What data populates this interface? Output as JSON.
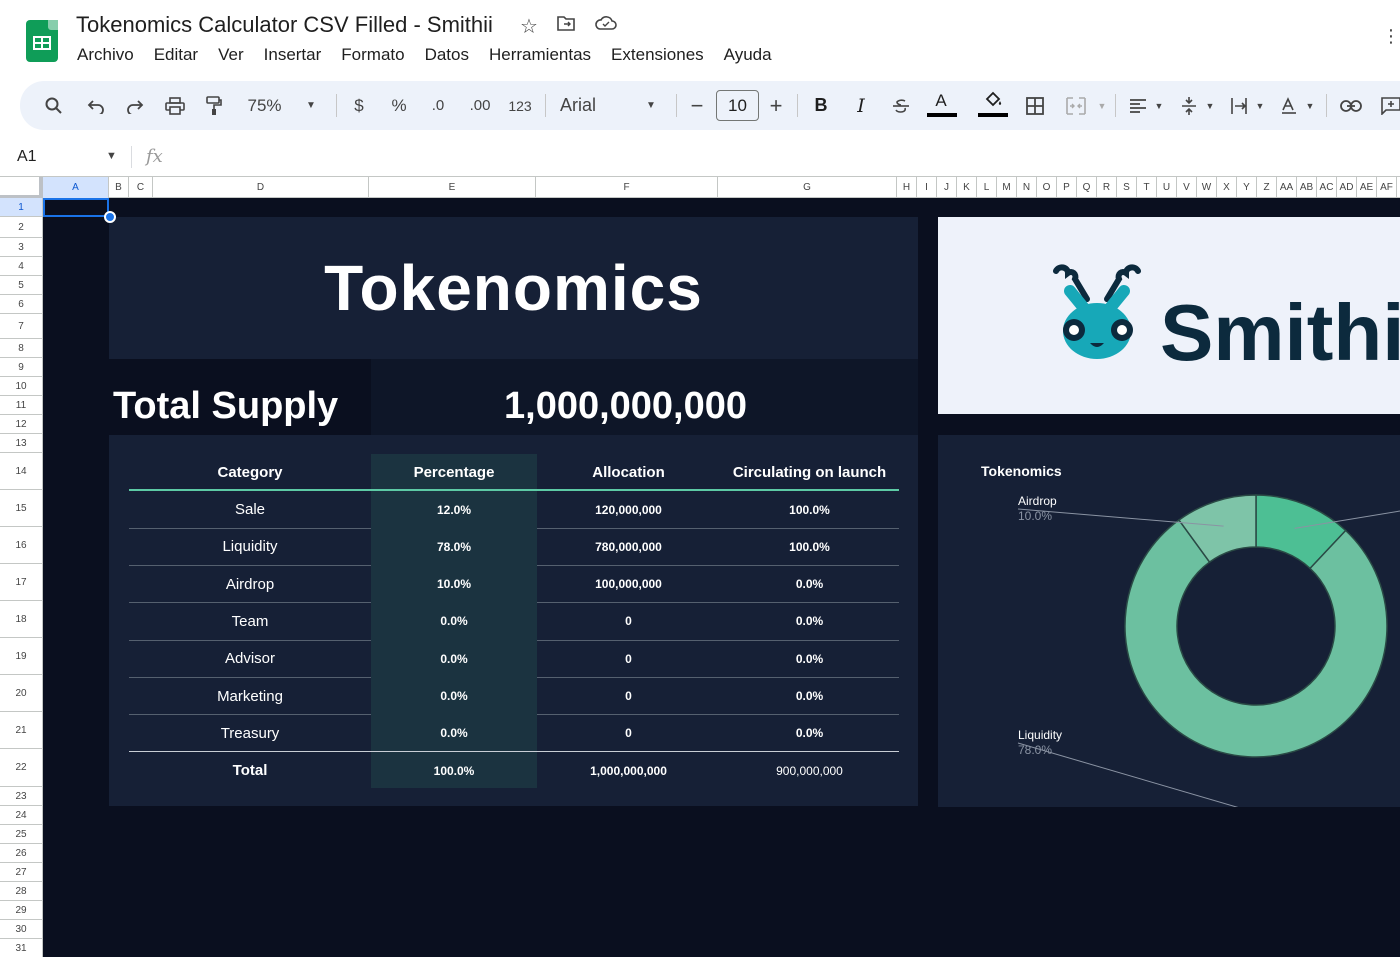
{
  "app": {
    "doc_title": "Tokenomics Calculator CSV Filled - Smithii",
    "menu": [
      "Archivo",
      "Editar",
      "Ver",
      "Insertar",
      "Formato",
      "Datos",
      "Herramientas",
      "Extensiones",
      "Ayuda"
    ]
  },
  "toolbar": {
    "zoom": "75%",
    "currency": "$",
    "percent": "%",
    "decrease_decimals": ".0",
    "increase_decimals": ".00",
    "number_format": "123",
    "font": "Arial",
    "font_size": "10",
    "bold": "B",
    "italic": "I",
    "text_color": "A"
  },
  "formula_bar": {
    "cell_ref": "A1",
    "fx": "fx",
    "value": ""
  },
  "columns": [
    "A",
    "B",
    "C",
    "D",
    "E",
    "F",
    "G",
    "H",
    "I",
    "J",
    "K",
    "L",
    "M",
    "N",
    "O",
    "P",
    "Q",
    "R",
    "S",
    "T",
    "U",
    "V",
    "W",
    "X",
    "Y",
    "Z",
    "AA",
    "AB",
    "AC",
    "AD",
    "AE",
    "AF"
  ],
  "rows": [
    "1",
    "2",
    "3",
    "4",
    "5",
    "6",
    "7",
    "8",
    "9",
    "10",
    "11",
    "12",
    "13",
    "14",
    "15",
    "16",
    "17",
    "18",
    "19",
    "20",
    "21",
    "22",
    "23",
    "24",
    "25",
    "26",
    "27",
    "28",
    "29",
    "30",
    "31"
  ],
  "sheet": {
    "title": "Tokenomics",
    "total_supply_label": "Total Supply",
    "total_supply_value": "1,000,000,000",
    "brand": "Smithii",
    "table": {
      "headers": [
        "Category",
        "Percentage",
        "Allocation",
        "Circulating on launch"
      ],
      "rows": [
        [
          "Sale",
          "12.0%",
          "120,000,000",
          "100.0%"
        ],
        [
          "Liquidity",
          "78.0%",
          "780,000,000",
          "100.0%"
        ],
        [
          "Airdrop",
          "10.0%",
          "100,000,000",
          "0.0%"
        ],
        [
          "Team",
          "0.0%",
          "0",
          "0.0%"
        ],
        [
          "Advisor",
          "0.0%",
          "0",
          "0.0%"
        ],
        [
          "Marketing",
          "0.0%",
          "0",
          "0.0%"
        ],
        [
          "Treasury",
          "0.0%",
          "0",
          "0.0%"
        ]
      ],
      "total": [
        "Total",
        "100.0%",
        "1,000,000,000",
        "900,000,000"
      ]
    }
  },
  "chart_data": {
    "type": "pie",
    "title": "Tokenomics",
    "categories": [
      "Sale",
      "Liquidity",
      "Airdrop",
      "Team",
      "Advisor",
      "Marketing",
      "Treasury"
    ],
    "values": [
      12.0,
      78.0,
      10.0,
      0.0,
      0.0,
      0.0,
      0.0
    ],
    "colors": [
      "#4dbf94",
      "#6cc0a0",
      "#7ec4a8"
    ],
    "donut": true,
    "labels_shown": [
      {
        "name": "Airdrop",
        "value": "10.0%"
      },
      {
        "name": "Liquidity",
        "value": "78.0%"
      }
    ],
    "background": "#162036"
  }
}
